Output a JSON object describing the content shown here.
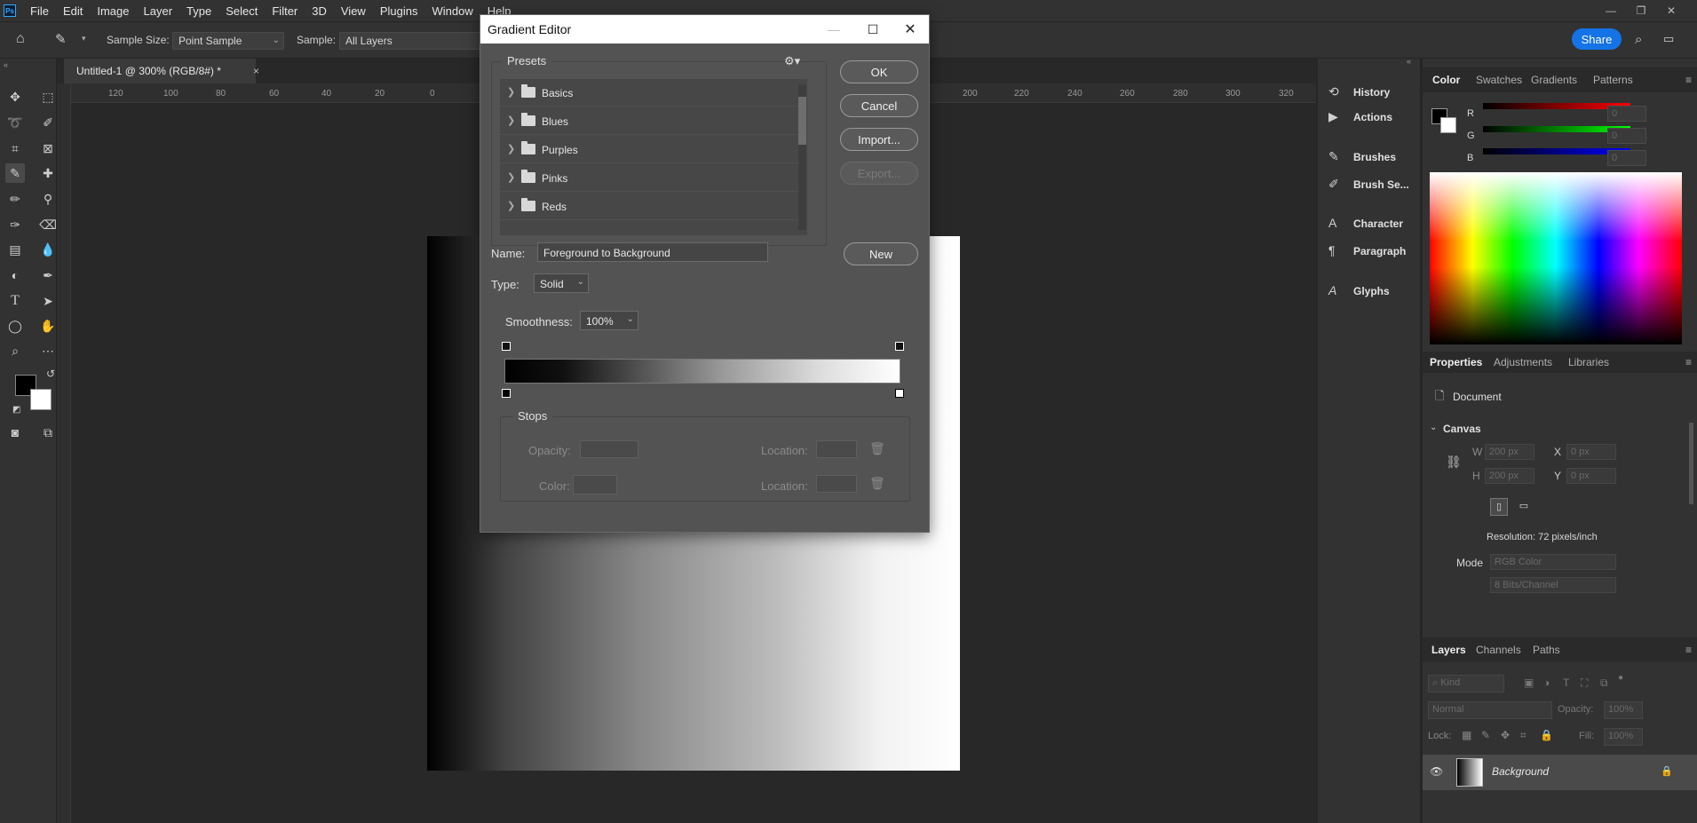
{
  "app": {
    "logo_text": "Ps",
    "menu": [
      "File",
      "Edit",
      "Image",
      "Layer",
      "Type",
      "Select",
      "Filter",
      "3D",
      "View",
      "Plugins",
      "Window",
      "Help"
    ]
  },
  "options_bar": {
    "sample_size_label": "Sample Size:",
    "sample_size_value": "Point Sample",
    "sample_label": "Sample:",
    "sample_value": "All Layers",
    "share_label": "Share"
  },
  "document": {
    "tab_title": "Untitled-1 @ 300% (RGB/8#) *",
    "close_glyph": "×",
    "ruler_labels": [
      "120",
      "100",
      "80",
      "60",
      "40",
      "20",
      "0",
      "200",
      "220",
      "240",
      "260",
      "280",
      "300",
      "320"
    ]
  },
  "gradient_editor": {
    "title": "Gradient Editor",
    "presets_label": "Presets",
    "presets": [
      "Basics",
      "Blues",
      "Purples",
      "Pinks",
      "Reds"
    ],
    "buttons": {
      "ok": "OK",
      "cancel": "Cancel",
      "import": "Import...",
      "export": "Export...",
      "new": "New"
    },
    "name_label": "Name:",
    "name_value": "Foreground to Background",
    "type_label": "Type:",
    "type_value": "Solid",
    "smoothness_label": "Smoothness:",
    "smoothness_value": "100%",
    "stops_label": "Stops",
    "opacity_label": "Opacity:",
    "color_label": "Color:",
    "location_label": "Location:"
  },
  "mini_panels": [
    "History",
    "Actions",
    "Brushes",
    "Brush Se...",
    "Character",
    "Paragraph",
    "Glyphs"
  ],
  "color_panel": {
    "tabs": [
      "Color",
      "Swatches",
      "Gradients",
      "Patterns"
    ],
    "channels": [
      "R",
      "G",
      "B"
    ],
    "values": [
      "0",
      "0",
      "0"
    ]
  },
  "properties_panel": {
    "tabs": [
      "Properties",
      "Adjustments",
      "Libraries"
    ],
    "document_label": "Document",
    "canvas_label": "Canvas",
    "w_label": "W",
    "w_value": "200 px",
    "h_label": "H",
    "h_value": "200 px",
    "x_label": "X",
    "x_value": "0 px",
    "y_label": "Y",
    "y_value": "0 px",
    "resolution": "Resolution: 72 pixels/inch",
    "mode_label": "Mode",
    "mode_value": "RGB Color",
    "bits_value": "8 Bits/Channel"
  },
  "layers_panel": {
    "tabs": [
      "Layers",
      "Channels",
      "Paths"
    ],
    "kind_placeholder": "Kind",
    "blend_mode": "Normal",
    "opacity_label": "Opacity:",
    "opacity_value": "100%",
    "lock_label": "Lock:",
    "fill_label": "Fill:",
    "fill_value": "100%",
    "layer_name": "Background"
  }
}
